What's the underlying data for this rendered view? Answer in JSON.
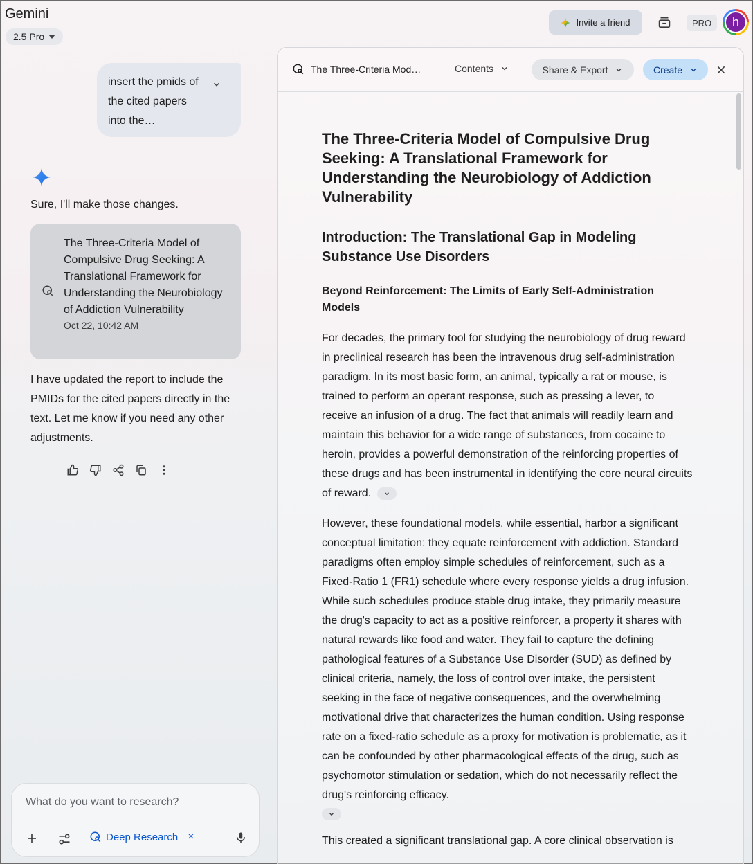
{
  "app": {
    "title": "Gemini",
    "model": "2.5 Pro"
  },
  "header": {
    "invite_label": "Invite a friend",
    "pro_badge": "PRO",
    "avatar_initial": "h"
  },
  "chat": {
    "user_message": "insert the pmids of the cited papers into the…",
    "reply_intro": "Sure, I'll make those changes.",
    "report_card": {
      "title": "The Three-Criteria Model of Compulsive Drug Seeking: A Translational Framework for Understanding the Neurobiology of Addiction Vulnerability",
      "date": "Oct 22, 10:42 AM"
    },
    "reply_body": "I have updated the report to include the PMIDs for the cited papers directly in the text. Let me know if you need any other adjustments."
  },
  "composer": {
    "placeholder": "What do you want to research?",
    "chip_label": "Deep Research",
    "chip_remove": "×"
  },
  "document": {
    "toolbar_title": "The Three-Criteria Mod…",
    "contents_label": "Contents",
    "share_label": "Share & Export",
    "create_label": "Create",
    "h1": "The Three-Criteria Model of Compulsive Drug Seeking: A Translational Framework for Understanding the Neurobiology of Addiction Vulnerability",
    "h2": "Introduction: The Translational Gap in Modeling Substance Use Disorders",
    "h3": "Beyond Reinforcement: The Limits of Early Self-Administration Models",
    "p1": "For decades, the primary tool for studying the neurobiology of drug reward in preclinical research has been the intravenous drug self-administration paradigm. In its most basic form, an animal, typically a rat or mouse, is trained to perform an operant response, such as pressing a lever, to receive an infusion of a drug. The fact that animals will readily learn and maintain this behavior for a wide range of substances, from cocaine to heroin, provides a powerful demonstration of the reinforcing properties of these drugs and has been instrumental in identifying the core neural circuits of reward.",
    "p2": "However, these foundational models, while essential, harbor a significant conceptual limitation: they equate reinforcement with addiction. Standard paradigms often employ simple schedules of reinforcement, such as a Fixed-Ratio 1 (FR1) schedule where every response yields a drug infusion. While such schedules produce stable drug intake, they primarily measure the drug's capacity to act as a positive reinforcer, a property it shares with natural rewards like food and water. They fail to capture the defining pathological features of a Substance Use Disorder (SUD) as defined by clinical criteria, namely, the loss of control over intake, the persistent seeking in the face of negative consequences, and the overwhelming motivational drive that characterizes the human condition. Using response rate on a fixed-ratio schedule as a proxy for motivation is problematic, as it can be confounded by other pharmacological effects of the drug, such as psychomotor stimulation or sedation, which do not necessarily reflect the drug's reinforcing efficacy.",
    "p3": "This created a significant translational gap. A core clinical observation is"
  }
}
